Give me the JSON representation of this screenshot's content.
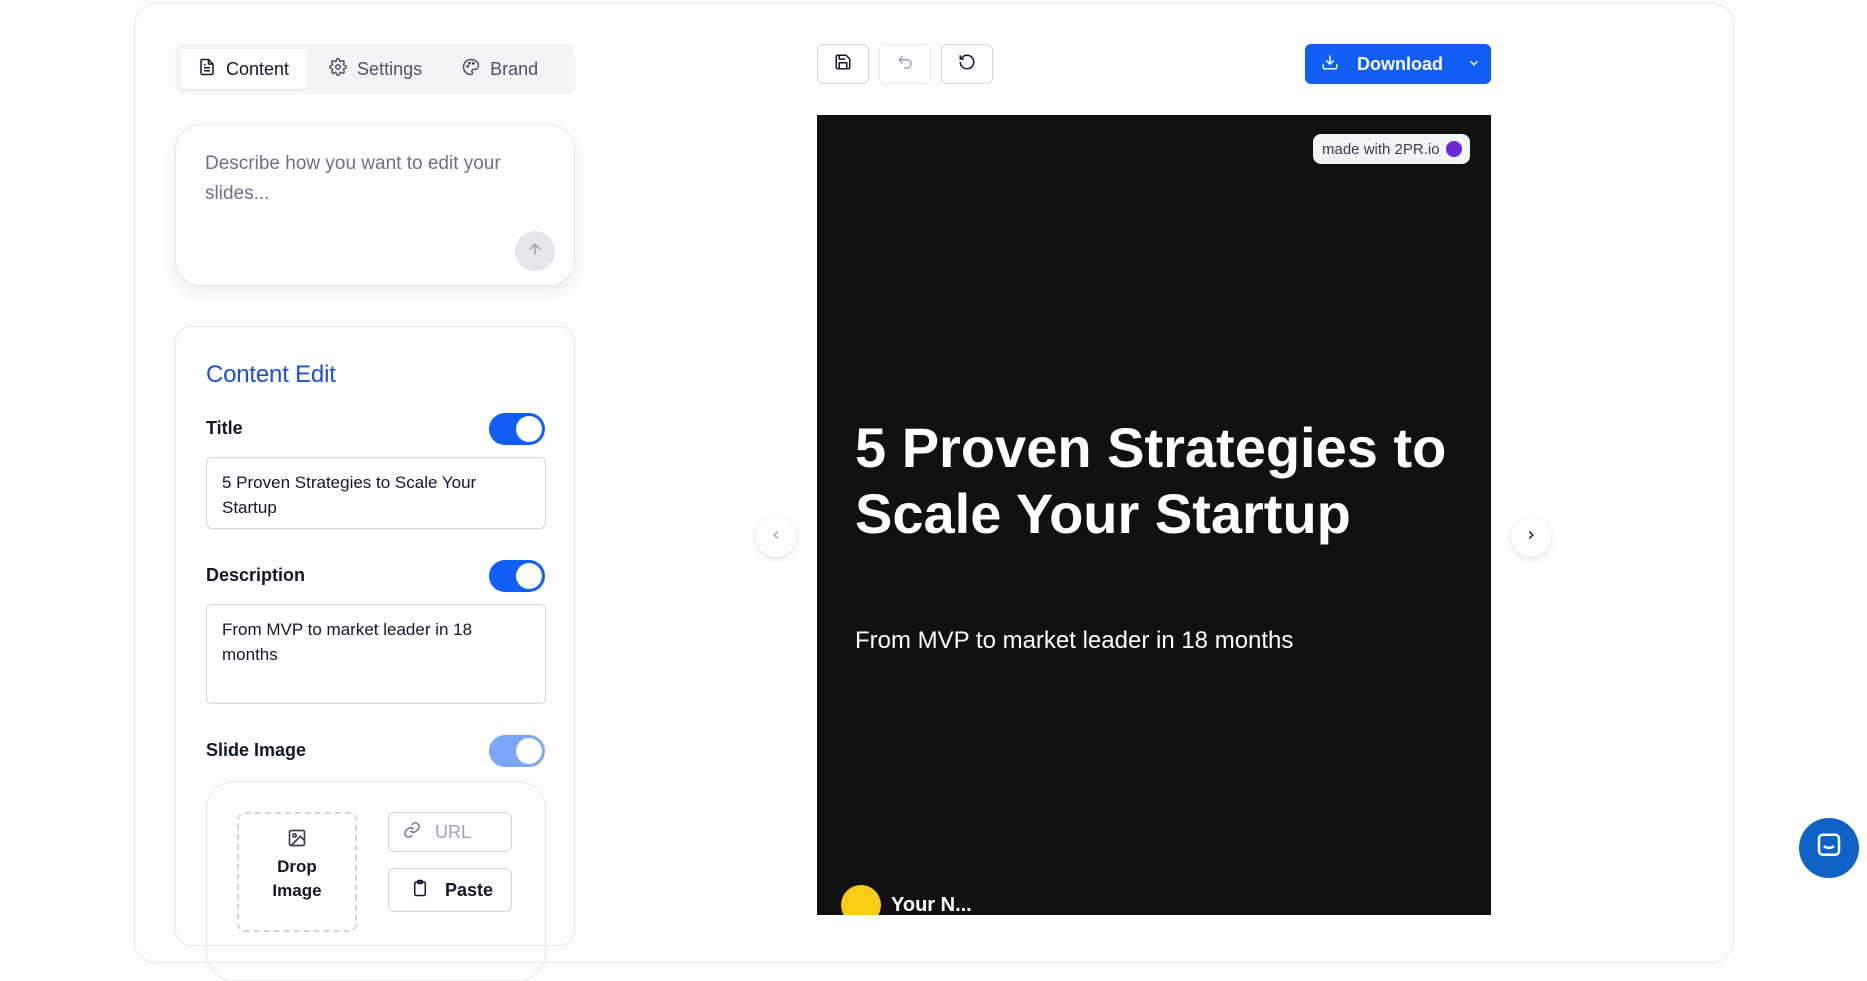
{
  "tabs": [
    {
      "label": "Content",
      "icon": "document-icon",
      "active": true
    },
    {
      "label": "Settings",
      "icon": "gear-icon",
      "active": false
    },
    {
      "label": "Brand",
      "icon": "palette-icon",
      "active": false
    }
  ],
  "prompt": {
    "placeholder": "Describe how you want to edit your slides..."
  },
  "content_edit": {
    "title": "Content Edit",
    "title_field": {
      "label": "Title",
      "value": "5 Proven Strategies to Scale Your Startup",
      "enabled": true
    },
    "description_field": {
      "label": "Description",
      "value": "From MVP to market leader in 18 months",
      "enabled": true
    },
    "image_field": {
      "label": "Slide Image",
      "enabled": true
    },
    "drop_label": "Drop Image",
    "url_placeholder": "URL",
    "paste_label": "Paste"
  },
  "toolbar": {
    "download_label": "Download"
  },
  "slide": {
    "watermark": "made with 2PR.io",
    "title": "5 Proven Strategies to Scale Your Startup",
    "description": "From MVP to market leader in 18 months",
    "author_name": "Your N..."
  },
  "colors": {
    "accent": "#0f5ef5",
    "slide_bg": "#101010",
    "title_link": "#1d4ed8"
  }
}
